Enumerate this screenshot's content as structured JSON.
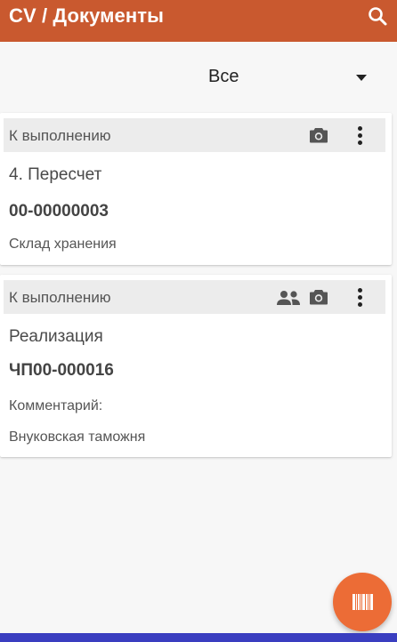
{
  "app_bar": {
    "title": "CV / Документы",
    "search_icon": "search-icon",
    "color": "#c9592f"
  },
  "filter": {
    "selected": "Все"
  },
  "documents": [
    {
      "status": "К выполнению",
      "icons": [
        "camera-icon",
        "more-vert-icon"
      ],
      "type": "4. Пересчет",
      "number": "00-00000003",
      "lines": [
        "Склад хранения"
      ]
    },
    {
      "status": "К выполнению",
      "icons": [
        "people-icon",
        "camera-icon",
        "more-vert-icon"
      ],
      "type": "Реализация",
      "number": "ЧП00-000016",
      "lines": [
        "Комментарий:",
        "Внуковская таможня"
      ]
    }
  ],
  "fab": {
    "icon": "barcode-icon",
    "color": "#ec6c36"
  },
  "nav_bar_color": "#3a3ec0"
}
